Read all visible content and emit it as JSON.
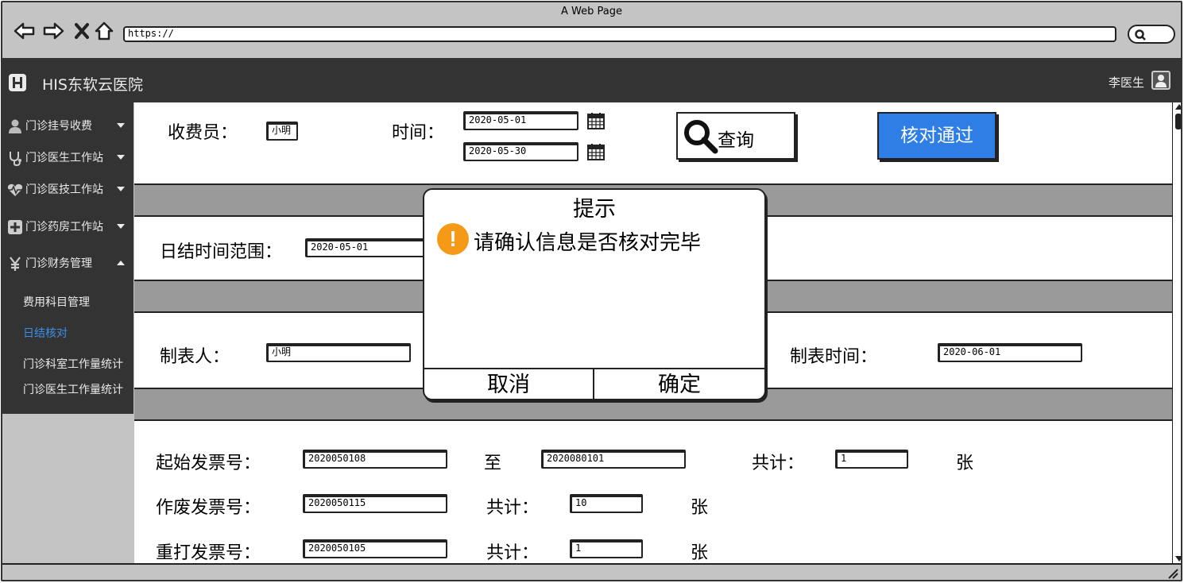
{
  "browser": {
    "window_title": "A Web Page",
    "url": "https://"
  },
  "header": {
    "app_title": "HIS东软云医院",
    "user_name": "李医生"
  },
  "sidebar": {
    "items": [
      {
        "label": "门诊挂号收费",
        "icon": "user-doctor-icon"
      },
      {
        "label": "门诊医生工作站",
        "icon": "stethoscope-icon"
      },
      {
        "label": "门诊医技工作站",
        "icon": "heartbeat-icon"
      },
      {
        "label": "门诊药房工作站",
        "icon": "plus-square-icon"
      },
      {
        "label": "门诊财务管理",
        "icon": "yen-icon"
      }
    ],
    "sub_items": [
      {
        "label": "费用科目管理"
      },
      {
        "label": "日结核对"
      },
      {
        "label": "门诊科室工作量统计"
      },
      {
        "label": "门诊医生工作量统计"
      }
    ]
  },
  "query_bar": {
    "cashier_label": "收费员：",
    "cashier_value": "小明",
    "time_label": "时间：",
    "start_date": "2020-05-01",
    "end_date": "2020-05-30",
    "query_button": "查询",
    "approve_button": "核对通过"
  },
  "settlement": {
    "range_label": "日结时间范围：",
    "range_start": "2020-05-01"
  },
  "report": {
    "maker_label": "制表人：",
    "maker_value": "小明",
    "time_label": "制表时间：",
    "time_value": "2020-06-01"
  },
  "invoices": {
    "start_label": "起始发票号：",
    "start_from": "2020050108",
    "to_label": "至",
    "start_to": "2020080101",
    "total_label": "共计：",
    "start_total": "1",
    "unit": "张",
    "void_label": "作废发票号：",
    "void_value": "2020050115",
    "void_total": "10",
    "reprint_label": "重打发票号：",
    "reprint_value": "2020050105",
    "reprint_total": "1"
  },
  "modal": {
    "title": "提示",
    "message": "请确认信息是否核对完毕",
    "cancel": "取消",
    "confirm": "确定"
  },
  "colors": {
    "dark_bar": "#333333",
    "accent_blue": "#2f7ee6",
    "warning_orange": "#f59a16"
  }
}
